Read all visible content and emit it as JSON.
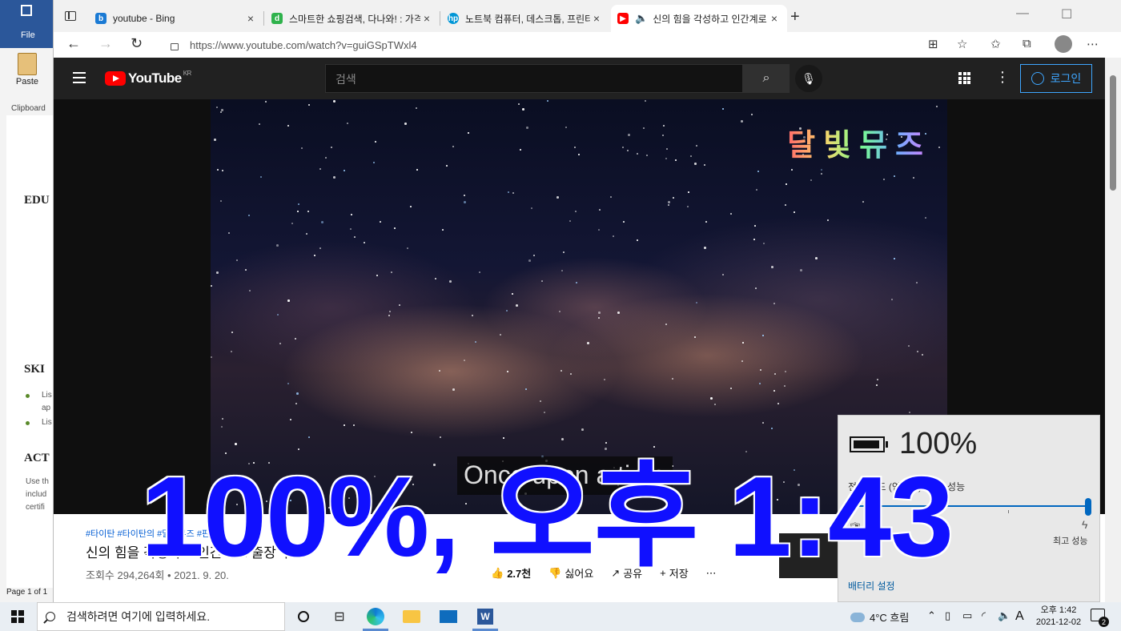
{
  "word": {
    "file_label": "File",
    "paste_label": "Paste",
    "clipboard_label": "Clipboard",
    "headings": [
      "EDU",
      "SKI",
      "ACT"
    ],
    "bullet_texts": [
      "Lis",
      "ap",
      "Lis"
    ],
    "body_texts": [
      "Use th",
      "includ",
      "certifi"
    ],
    "status": "Page 1 of 1"
  },
  "browser": {
    "tabs": [
      {
        "title": "youtube - Bing",
        "favicon": "bing-icon",
        "color": "#1a7ad4"
      },
      {
        "title": "스마트한 쇼핑검색, 다나와! : 가격",
        "favicon": "danawa-icon",
        "color": "#2fb24c"
      },
      {
        "title": "노트북 컴퓨터, 데스크톱, 프린터",
        "favicon": "hp-icon",
        "color": "#0096d6"
      },
      {
        "title": "신의 힘을 각성하고 인간계로",
        "favicon": "youtube-icon",
        "color": "#ff0000"
      }
    ],
    "url": "https://www.youtube.com/watch?v=guiGSpTWxl4"
  },
  "youtube": {
    "logo_text": "YouTube",
    "region": "KR",
    "search_placeholder": "검색",
    "login_label": "로그인",
    "video_title_overlay": "달빛뮤즈",
    "caption": "Once upon a time",
    "tags": "#타이탄 #타이탄의 #달빛뮤즈 #판",
    "title": "신의 힘을 각성하고 인간계로 출장 누르",
    "views": "조회수 294,264회 • 2021. 9. 20.",
    "actions": {
      "like": "2.7천",
      "dislike": "싫어요",
      "share": "공유",
      "save": "저장"
    }
  },
  "battery_flyout": {
    "percent": "100%",
    "power_mode_label": "전원 모드 (연결됨): 최고 성능",
    "best_performance": "최고 성능",
    "settings_link": "배터리 설정",
    "slider_level": 1.0
  },
  "overlay_text": "100%, 오후 1:43",
  "taskbar": {
    "search_placeholder": "검색하려면 여기에 입력하세요.",
    "weather": "4°C  흐림",
    "ime": "A",
    "time": "오후 1:42",
    "date": "2021-12-02",
    "notification_count": "2"
  }
}
